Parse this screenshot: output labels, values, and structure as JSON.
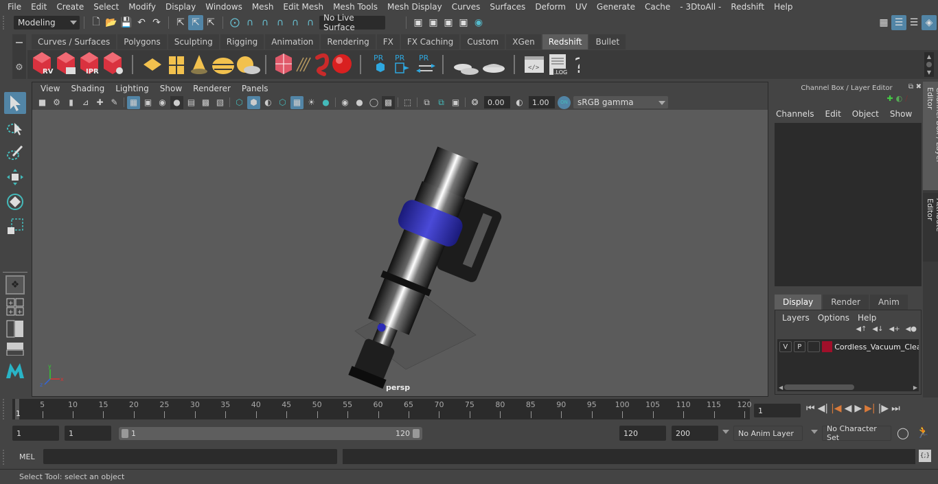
{
  "menubar": {
    "items": [
      "File",
      "Edit",
      "Create",
      "Select",
      "Modify",
      "Display",
      "Windows",
      "Mesh",
      "Edit Mesh",
      "Mesh Tools",
      "Mesh Display",
      "Curves",
      "Surfaces",
      "Deform",
      "UV",
      "Generate",
      "Cache",
      "- 3DtoAll -",
      "Redshift",
      "Help"
    ]
  },
  "statusline": {
    "mode_dropdown": "Modeling",
    "live_surface": "No Live Surface"
  },
  "shelf": {
    "tabs": [
      "Curves / Surfaces",
      "Polygons",
      "Sculpting",
      "Rigging",
      "Animation",
      "Rendering",
      "FX",
      "FX Caching",
      "Custom",
      "XGen",
      "Redshift",
      "Bullet"
    ],
    "active_tab": "Redshift",
    "icons": [
      {
        "name": "redshift-render-view-icon",
        "label": "RV"
      },
      {
        "name": "redshift-batch-render-icon",
        "label": ""
      },
      {
        "name": "redshift-ipr-icon",
        "label": "IPR"
      },
      {
        "name": "redshift-settings-icon",
        "label": ""
      },
      {
        "name": "redshift-area-light-icon",
        "label": ""
      },
      {
        "name": "redshift-portal-light-icon",
        "label": ""
      },
      {
        "name": "redshift-spot-light-icon",
        "label": ""
      },
      {
        "name": "redshift-dome-light-icon",
        "label": ""
      },
      {
        "name": "redshift-sun-sky-icon",
        "label": ""
      },
      {
        "name": "redshift-volume-icon",
        "label": ""
      },
      {
        "name": "redshift-hair-icon",
        "label": ""
      },
      {
        "name": "redshift-mesh-light-icon",
        "label": ""
      },
      {
        "name": "redshift-material-ball-icon",
        "label": ""
      },
      {
        "name": "redshift-proxy-icon",
        "label": "PR"
      },
      {
        "name": "redshift-proxy-export-icon",
        "label": "PR"
      },
      {
        "name": "redshift-proxy-convert-icon",
        "label": "PR"
      },
      {
        "name": "redshift-bake-sets-icon",
        "label": ""
      },
      {
        "name": "redshift-bake-icon",
        "label": ""
      },
      {
        "name": "redshift-script-editor-icon",
        "label": ""
      },
      {
        "name": "redshift-log-icon",
        "label": ".LOG"
      },
      {
        "name": "redshift-help-icon",
        "label": "?"
      }
    ]
  },
  "viewport": {
    "menu": [
      "View",
      "Shading",
      "Lighting",
      "Show",
      "Renderer",
      "Panels"
    ],
    "exposure": "0.00",
    "gamma": "1.00",
    "color_management": "sRGB gamma",
    "camera_label": "persp"
  },
  "channel_box": {
    "title": "Channel Box / Layer Editor",
    "menu": [
      "Channels",
      "Edit",
      "Object",
      "Show"
    ]
  },
  "layer_editor": {
    "tabs": [
      "Display",
      "Render",
      "Anim"
    ],
    "active_tab": "Display",
    "menu": [
      "Layers",
      "Options",
      "Help"
    ],
    "layers": [
      {
        "visible": "V",
        "playback": "P",
        "color": "#a0102a",
        "name": "Cordless_Vacuum_Clea"
      }
    ]
  },
  "side_tabs": [
    "Channel Box / Layer Editor",
    "Attribute Editor"
  ],
  "timeline": {
    "ticks": [
      5,
      10,
      15,
      20,
      25,
      30,
      35,
      40,
      45,
      50,
      55,
      60,
      65,
      70,
      75,
      80,
      85,
      90,
      95,
      100,
      105,
      110,
      115,
      120
    ],
    "range_min": 1,
    "range_max": 120,
    "current_frame_marker": "1",
    "current_frame": "1"
  },
  "range_slider": {
    "start_frame": "1",
    "playback_start": "1",
    "slider_start": "1",
    "slider_end": "120",
    "playback_end": "120",
    "end_frame": "200",
    "anim_layer": "No Anim Layer",
    "character_set": "No Character Set"
  },
  "command_line": {
    "language": "MEL",
    "input": "",
    "result": ""
  },
  "status": {
    "help_text": "Select Tool: select an object"
  }
}
